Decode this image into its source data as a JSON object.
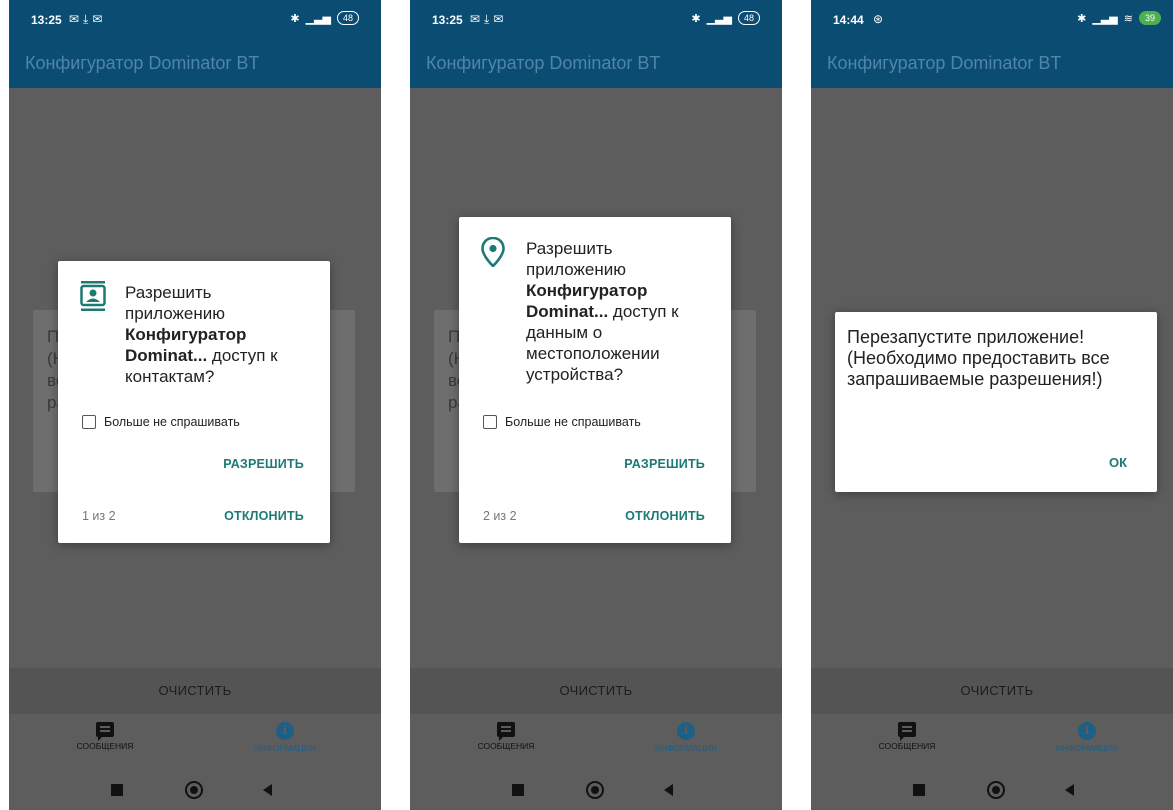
{
  "colors": {
    "primary": "#0b4c73",
    "accent": "#1b7a73",
    "info": "#1e5f86"
  },
  "app_title": "Конфигуратор Dominator BT",
  "clear_label": "ОЧИСТИТЬ",
  "nav": {
    "messages": "СООБЩЕНИЯ",
    "info": "ИНФОРМАЦИЯ"
  },
  "screens": [
    {
      "time": "13:25",
      "battery": "48",
      "dialog": {
        "icon": "contacts-icon",
        "text_before": "Разрешить приложению ",
        "app_name": "Конфигуратор Dominat...",
        "text_after": " доступ к контактам?",
        "checkbox_label": "Больше не спрашивать",
        "allow": "РАЗРЕШИТЬ",
        "deny": "ОТКЛОНИТЬ",
        "counter": "1 из 2"
      },
      "underlying_text": "П (Н вс ра"
    },
    {
      "time": "13:25",
      "battery": "48",
      "dialog": {
        "icon": "location-pin-icon",
        "text_before": "Разрешить приложению ",
        "app_name": "Конфигуратор Dominat...",
        "text_after": " доступ к данным о местоположении устройства?",
        "checkbox_label": "Больше не спрашивать",
        "allow": "РАЗРЕШИТЬ",
        "deny": "ОТКЛОНИТЬ",
        "counter": "2 из 2"
      },
      "underlying_text": "П (Н вс ра"
    },
    {
      "time": "14:44",
      "battery": "39",
      "alert": {
        "message": "Перезапустите приложение! (Необходимо предоставить все запрашиваемые разрешения!)",
        "ok": "ОК"
      }
    }
  ]
}
